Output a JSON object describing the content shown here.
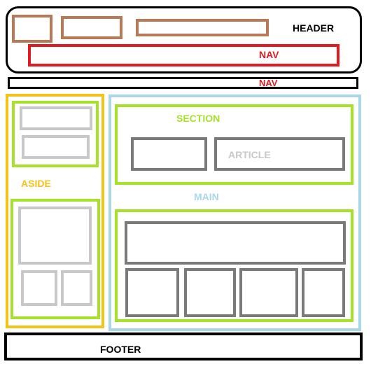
{
  "labels": {
    "header": "HEADER",
    "nav_inner": "NAV",
    "nav_outer": "NAV",
    "section": "SECTION",
    "article": "ARTICLE",
    "aside": "ASIDE",
    "main": "MAIN",
    "footer": "FOOTER"
  },
  "colors": {
    "header": "#000000",
    "header_boxes": "#b87a56",
    "nav": "#e21b23",
    "aside": "#f5c219",
    "section_green": "#a6e22a",
    "main": "#a8d8e8",
    "gray_dark": "#7a7a7a",
    "gray_light": "#c8c8c8",
    "footer": "#000000"
  }
}
